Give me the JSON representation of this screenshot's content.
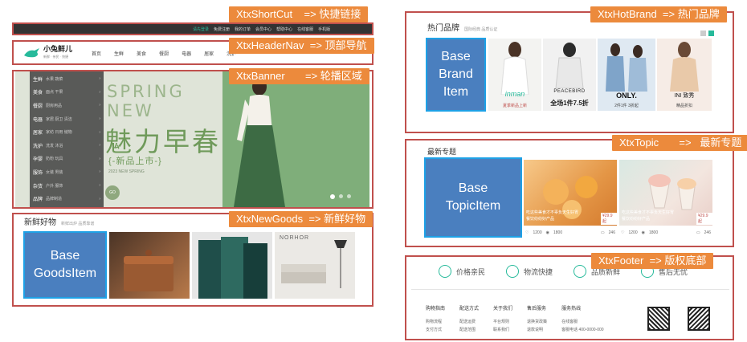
{
  "labels": {
    "shortcut": "XtxShortCut    => 快捷链接",
    "headernav": "XtxHeaderNav  => 顶部导航",
    "banner": "XtxBanner       => 轮播区域",
    "newgoods": "XtxNewGoods  => 新鲜好物",
    "hotbrand": "XtxHotBrand  => 热门品牌",
    "topic": "XtxTopic       =>   最新专题",
    "footer": "XtxFooter  => 版权底部"
  },
  "boxes": {
    "goods_item": "Base\nGoodsItem",
    "brand_item": "Base\nBrand\nItem",
    "topic_item": "Base\nTopicItem"
  },
  "shortcut_links": [
    "请先登录",
    "免费注册",
    "我的订单",
    "会员中心",
    "帮助中心",
    "在线客服",
    "手机版"
  ],
  "logo": {
    "title": "小兔鲜儿",
    "slogan": "新鲜 · 亲民 · 快捷"
  },
  "nav_items": [
    "首页",
    "生鲜",
    "美食",
    "餐厨",
    "电器",
    "居家",
    "洗护"
  ],
  "banner": {
    "categories": [
      [
        "生鲜",
        "水果 蔬菜"
      ],
      [
        "美食",
        "面点 干果"
      ],
      [
        "餐厨",
        "厨房用品"
      ],
      [
        "电器",
        "家居 厨卫 清洁"
      ],
      [
        "居家",
        "家纺 日用 储物"
      ],
      [
        "洗护",
        "洗发 沐浴"
      ],
      [
        "孕婴",
        "奶粉 玩具"
      ],
      [
        "服饰",
        "女装 男装"
      ],
      [
        "杂货",
        "户外 服饰"
      ],
      [
        "品牌",
        "品牌制造"
      ]
    ],
    "spring_line1": "SPRING",
    "spring_line2": "NEW",
    "headline": "魅力早春",
    "subline": "{-新品上市-}",
    "small_caption": "2023 NEW SPRING",
    "go": "GO"
  },
  "new_goods": {
    "title": "新鲜好物",
    "subtitle": "新鲜出炉 品质靠谱",
    "furniture_brand": "NORHOR"
  },
  "hot_brand": {
    "title": "热门品牌",
    "subtitle": "国际经典 品质认证",
    "brands": [
      {
        "name": "inman",
        "caption": "夏季新品上新"
      },
      {
        "name": "PEACEBIRD",
        "caption": "全场1件7.5折"
      },
      {
        "name": "ONLY.",
        "caption": "2件1件 3折起"
      },
      {
        "name": "INI 致秀",
        "caption": "精品折扣"
      }
    ]
  },
  "topic": {
    "title": "最新专题",
    "cards": [
      {
        "caption": "吃这些美食才不辜负天生好胃",
        "sub": "餐饮纷纷好产品",
        "price": "¥29.9起",
        "likes": "1200",
        "views": "1800",
        "comments": "246"
      },
      {
        "caption": "吃这些美食才不辜负天生好胃",
        "sub": "餐饮纷纷好产品",
        "price": "¥29.9起",
        "likes": "1200",
        "views": "1800",
        "comments": "246"
      }
    ]
  },
  "footer": {
    "promises": [
      "价格亲民",
      "物流快捷",
      "品质新鲜",
      "售后无忧"
    ],
    "columns": [
      {
        "head": "购物指南",
        "items": [
          "购物流程",
          "支付方式"
        ]
      },
      {
        "head": "配送方式",
        "items": [
          "配送运费",
          "配送范围"
        ]
      },
      {
        "head": "关于我们",
        "items": [
          "平台规则",
          "联系我们"
        ]
      },
      {
        "head": "售后服务",
        "items": [
          "退换货政策",
          "退款说明"
        ]
      },
      {
        "head": "服务热线",
        "items": [
          "在线客服",
          "客服电话 400-0000-000"
        ]
      }
    ]
  }
}
